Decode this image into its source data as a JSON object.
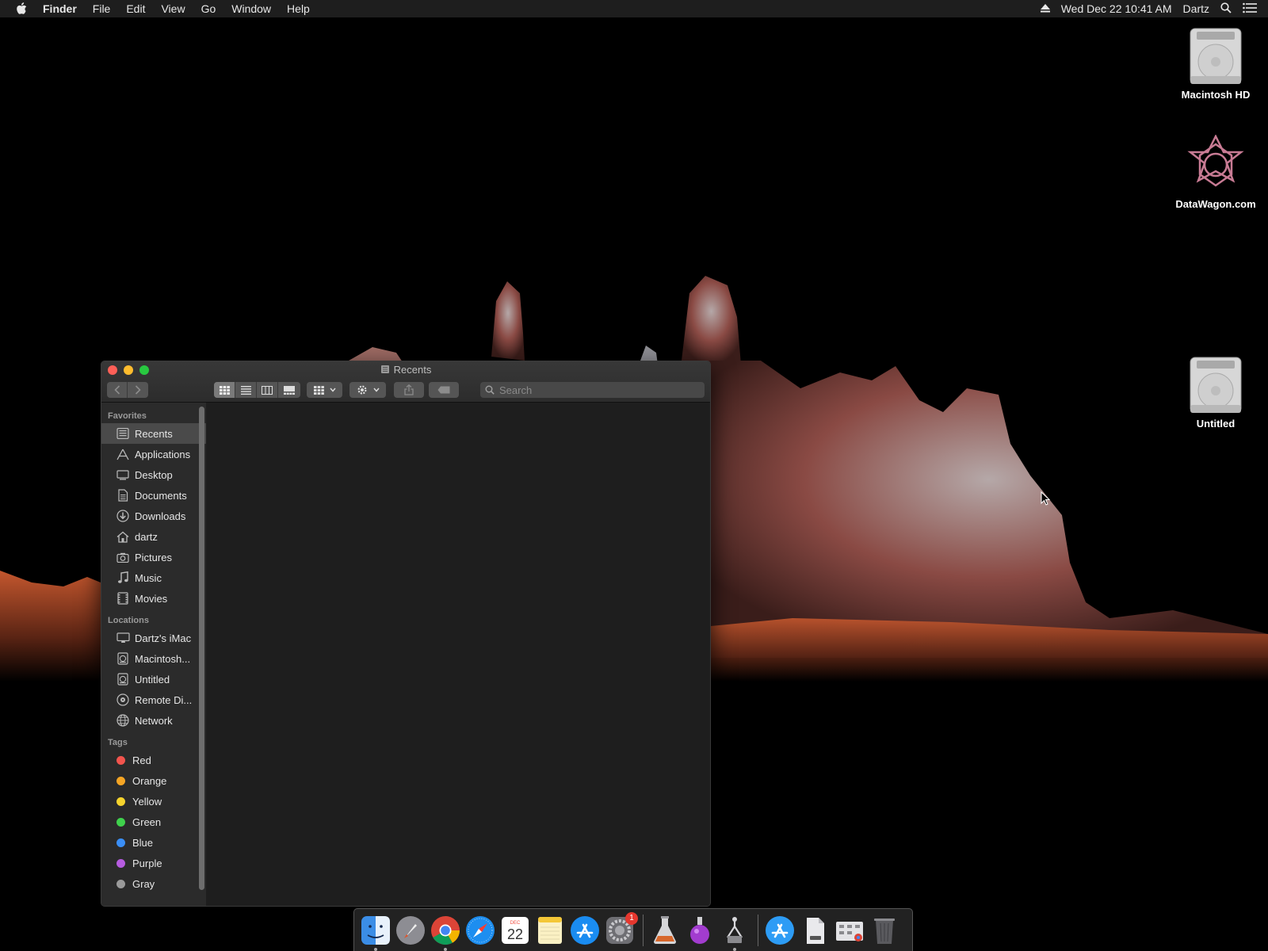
{
  "menubar": {
    "app_name": "Finder",
    "items": [
      "File",
      "Edit",
      "View",
      "Go",
      "Window",
      "Help"
    ],
    "clock": "Wed Dec 22  10:41 AM",
    "user": "Dartz"
  },
  "desktop_icons": [
    {
      "label": "Macintosh HD",
      "icon": "hard-drive-icon"
    },
    {
      "label": "DataWagon.com",
      "icon": "datawagon-logo-icon"
    },
    {
      "label": "Untitled",
      "icon": "hard-drive-icon"
    }
  ],
  "window": {
    "title": "Recents",
    "search_placeholder": "Search",
    "view_modes": [
      "icon",
      "list",
      "column",
      "gallery"
    ],
    "active_view": "icon"
  },
  "sidebar": {
    "favorites_header": "Favorites",
    "favorites": [
      {
        "label": "Recents",
        "icon": "recents-icon",
        "selected": true
      },
      {
        "label": "Applications",
        "icon": "applications-icon"
      },
      {
        "label": "Desktop",
        "icon": "desktop-icon"
      },
      {
        "label": "Documents",
        "icon": "documents-icon"
      },
      {
        "label": "Downloads",
        "icon": "downloads-icon"
      },
      {
        "label": "dartz",
        "icon": "home-icon"
      },
      {
        "label": "Pictures",
        "icon": "pictures-icon"
      },
      {
        "label": "Music",
        "icon": "music-icon"
      },
      {
        "label": "Movies",
        "icon": "movies-icon"
      }
    ],
    "locations_header": "Locations",
    "locations": [
      {
        "label": "Dartz's iMac",
        "icon": "imac-icon"
      },
      {
        "label": "Macintosh...",
        "icon": "disk-icon"
      },
      {
        "label": "Untitled",
        "icon": "disk-icon"
      },
      {
        "label": "Remote Di...",
        "icon": "remote-disc-icon"
      },
      {
        "label": "Network",
        "icon": "network-icon"
      }
    ],
    "tags_header": "Tags",
    "tags": [
      {
        "label": "Red",
        "color": "#f2544d"
      },
      {
        "label": "Orange",
        "color": "#f5a524"
      },
      {
        "label": "Yellow",
        "color": "#f6d32d"
      },
      {
        "label": "Green",
        "color": "#3fd14c"
      },
      {
        "label": "Blue",
        "color": "#3a8ef6"
      },
      {
        "label": "Purple",
        "color": "#b65ce0"
      },
      {
        "label": "Gray",
        "color": "#9a9a9a"
      }
    ]
  },
  "dock": {
    "items": [
      {
        "name": "finder-icon",
        "running": true
      },
      {
        "name": "launchpad-icon"
      },
      {
        "name": "chrome-icon",
        "running": true
      },
      {
        "name": "safari-icon"
      },
      {
        "name": "calendar-icon",
        "text": "22",
        "month": "DEC"
      },
      {
        "name": "notes-icon"
      },
      {
        "name": "app-store-icon"
      },
      {
        "name": "system-preferences-icon",
        "badge": "1"
      },
      {
        "name": "flask-app-icon"
      },
      {
        "name": "purple-flask-icon"
      },
      {
        "name": "connector-icon",
        "running": true
      },
      {
        "name": "app-store-folder-icon"
      },
      {
        "name": "document-icon"
      },
      {
        "name": "chrome-apps-icon"
      },
      {
        "name": "trash-icon"
      }
    ]
  }
}
